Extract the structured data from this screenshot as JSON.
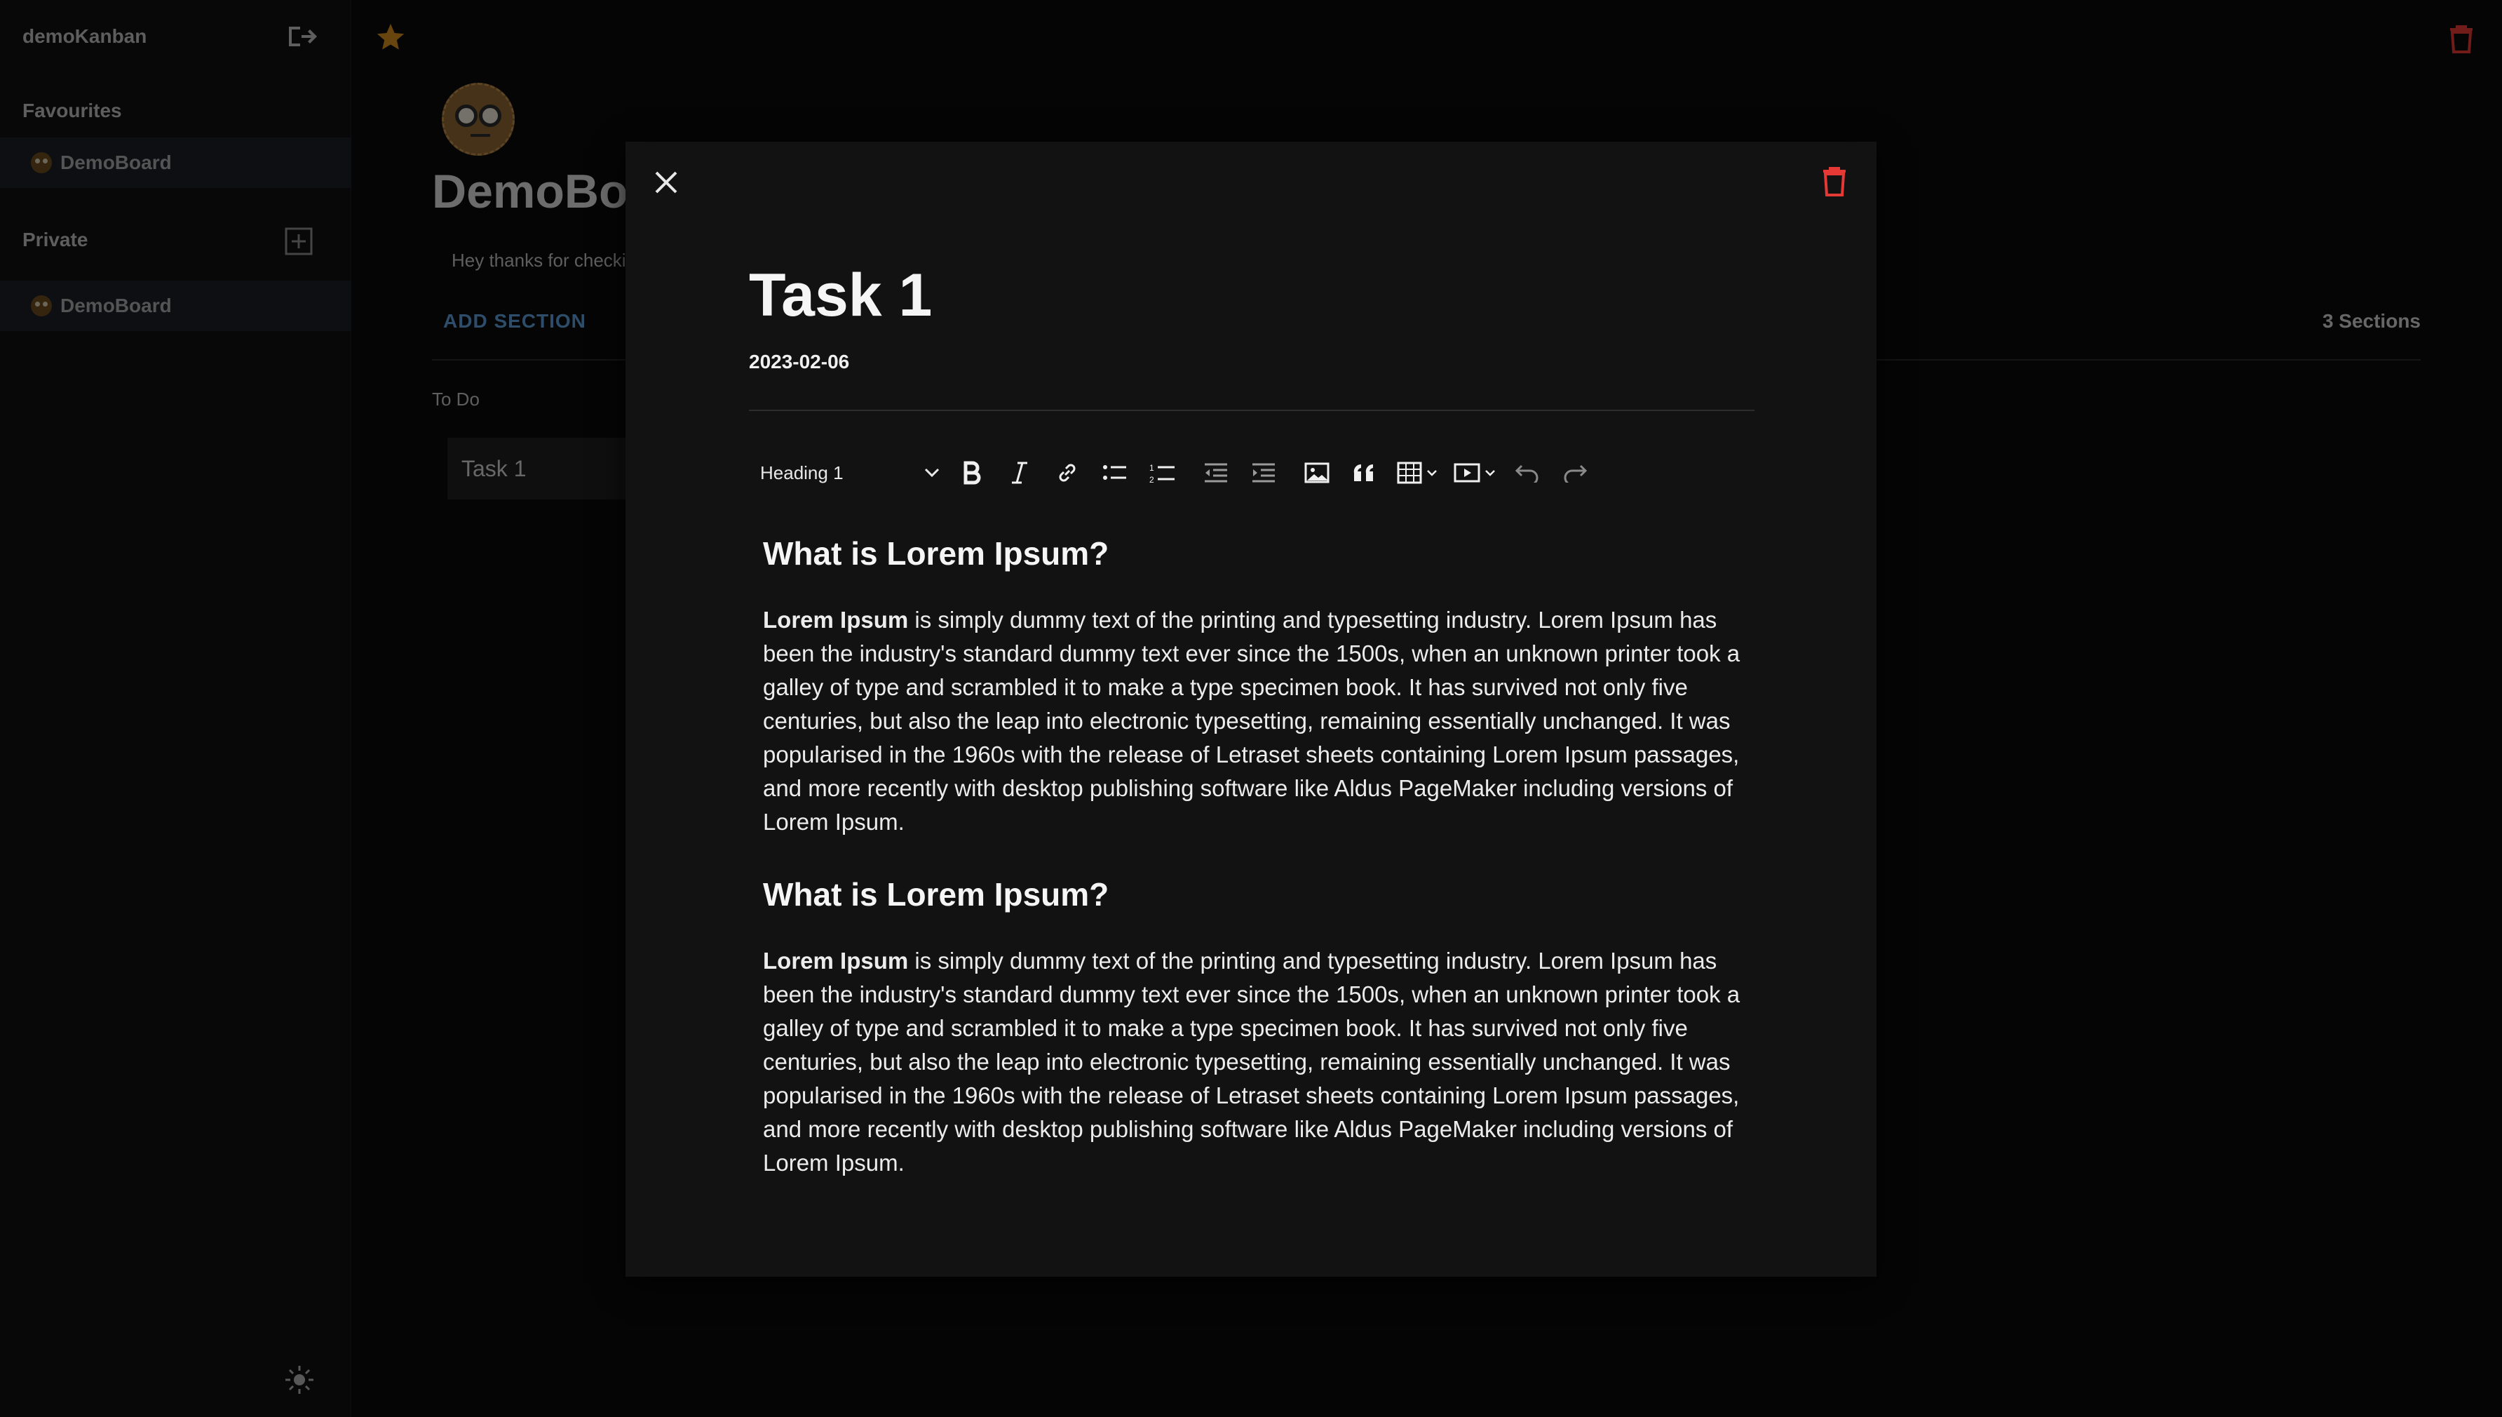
{
  "sidebar": {
    "app_title": "demoKanban",
    "favourites_label": "Favourites",
    "favourites": [
      {
        "label": "DemoBoard"
      }
    ],
    "private_label": "Private",
    "private": [
      {
        "label": "DemoBoard"
      }
    ]
  },
  "board": {
    "title": "DemoBoard",
    "description": "Hey thanks for checking out this demo",
    "add_section_label": "ADD SECTION",
    "sections_count": "3 Sections",
    "column_title": "To Do",
    "task_card": "Task 1"
  },
  "task_modal": {
    "title": "Task 1",
    "date": "2023-02-06",
    "toolbar": {
      "heading_select": "Heading 1",
      "buttons": [
        "bold",
        "italic",
        "link",
        "bulleted-list",
        "numbered-list",
        "outdent",
        "indent",
        "image",
        "blockquote",
        "table",
        "media",
        "undo",
        "redo"
      ]
    },
    "content": [
      {
        "heading": "What is Lorem Ipsum?",
        "bold_lead": "Lorem Ipsum",
        "text": " is simply dummy text of the printing and typesetting industry. Lorem Ipsum has been the industry's standard dummy text ever since the 1500s, when an unknown printer took a galley of type and scrambled it to make a type specimen book. It has survived not only five centuries, but also the leap into electronic typesetting, remaining essentially unchanged. It was popularised in the 1960s with the release of Letraset sheets containing Lorem Ipsum passages, and more recently with desktop publishing software like Aldus PageMaker including versions of Lorem Ipsum."
      },
      {
        "heading": "What is Lorem Ipsum?",
        "bold_lead": "Lorem Ipsum",
        "text": " is simply dummy text of the printing and typesetting industry. Lorem Ipsum has been the industry's standard dummy text ever since the 1500s, when an unknown printer took a galley of type and scrambled it to make a type specimen book. It has survived not only five centuries, but also the leap into electronic typesetting, remaining essentially unchanged. It was popularised in the 1960s with the release of Letraset sheets containing Lorem Ipsum passages, and more recently with desktop publishing software like Aldus PageMaker including versions of Lorem Ipsum."
      }
    ]
  },
  "colors": {
    "accent_blue": "#5a9bd5",
    "star": "#d18a1f",
    "danger": "#e53935"
  }
}
